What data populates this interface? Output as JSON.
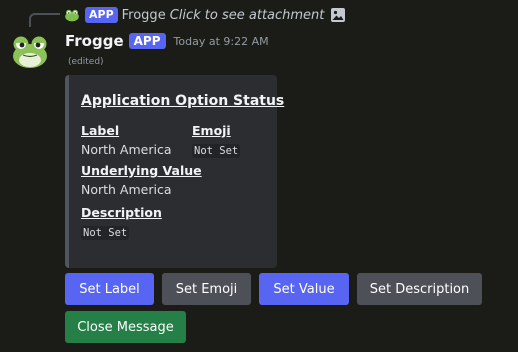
{
  "reply": {
    "author": "Frogge",
    "badge": "APP",
    "text": "Click to see attachment"
  },
  "message": {
    "author": "Frogge",
    "badge": "APP",
    "timestamp": "Today at 9:22 AM",
    "edited": "(edited)"
  },
  "embed": {
    "title": "Application Option Status",
    "fields": {
      "label_name": "Label",
      "label_value": "North America",
      "emoji_name": "Emoji",
      "emoji_value": "Not Set",
      "underlying_name": "Underlying Value",
      "underlying_value": "North America",
      "description_name": "Description",
      "description_value": "Not Set"
    }
  },
  "buttons": {
    "set_label": "Set Label",
    "set_emoji": "Set Emoji",
    "set_value": "Set Value",
    "set_description": "Set Description",
    "close_message": "Close Message"
  },
  "colors": {
    "background": "#1b1c17",
    "embed_background": "#2b2d31",
    "blurple": "#5865f2",
    "secondary": "#4e5058",
    "success": "#248046"
  }
}
